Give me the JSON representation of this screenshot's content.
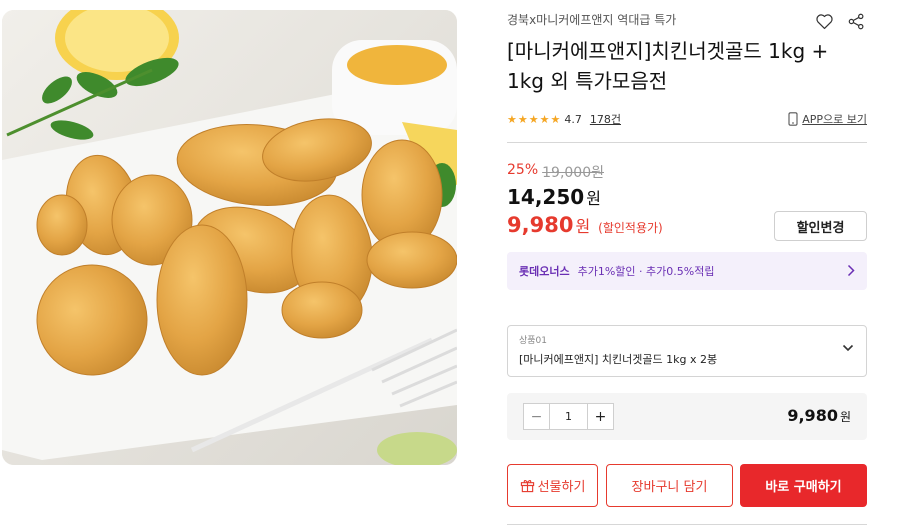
{
  "product_image": {
    "description_icon": "product-photo"
  },
  "promo_label": "경북x마니커에프앤지 역대급 특가",
  "title": "[마니커에프앤지]치킨너겟골드 1kg + 1kg 외 특가모음전",
  "rating": {
    "stars": 5,
    "value": "4.7",
    "review_count": "178건"
  },
  "app_link": "APP으로 보기",
  "pricing": {
    "discount_rate": "25%",
    "original_price": "19,000원",
    "list_price": "14,250",
    "list_price_unit": "원",
    "sale_price": "9,980",
    "sale_unit": "원",
    "sale_note": "(할인적용가)",
    "change_button": "할인변경"
  },
  "card_banner": {
    "name": "롯데오너스",
    "benefit": "추가1%할인 · 추가0.5%적립"
  },
  "option": {
    "label": "상품01",
    "value": "[마니커에프앤지] 치킨너겟골드 1kg x 2봉"
  },
  "quantity": {
    "value": "1",
    "minus": "−",
    "plus": "+",
    "total": "9,980",
    "total_unit": "원"
  },
  "actions": {
    "gift": "선물하기",
    "cart": "장바구니 담기",
    "buy": "바로 구매하기"
  },
  "colors": {
    "accent": "#e63a2e",
    "buy_bg": "#e8282b",
    "card_purple": "#6a2fb4",
    "star": "#f5a623"
  },
  "icons": [
    "heart-icon",
    "share-icon",
    "mobile-icon",
    "chevron-right-icon",
    "chevron-down-icon",
    "gift-icon"
  ]
}
